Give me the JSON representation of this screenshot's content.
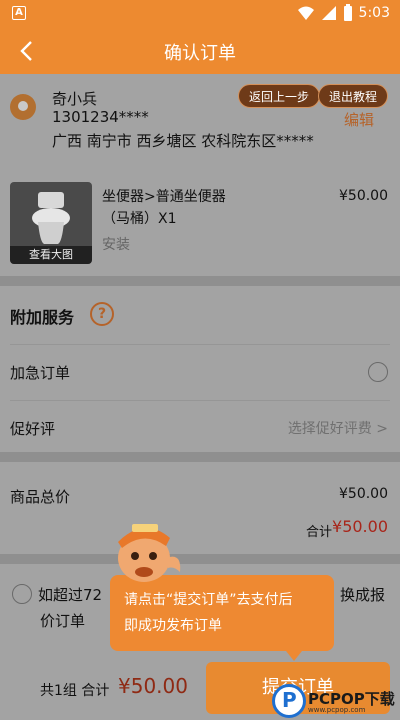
{
  "status_bar": {
    "app_glyph": "A",
    "time": "5:03",
    "icons": [
      "wifi-icon",
      "signal-icon",
      "battery-icon"
    ]
  },
  "header": {
    "title": "确认订单",
    "back_icon": "chevron-left-icon"
  },
  "address": {
    "name": "奇小兵",
    "phone": "1301234****",
    "full": "广西 南宁市 西乡塘区 农科院东区*****",
    "prev_step_label": "返回上一步",
    "exit_tutorial_label": "退出教程",
    "edit_label": "编辑"
  },
  "product": {
    "name": "坐便器>普通坐便器（马桶）X1",
    "service": "安装",
    "price": "¥50.00",
    "thumb_caption": "查看大图"
  },
  "services": {
    "title": "附加服务",
    "help_glyph": "?",
    "urgent_label": "加急订单",
    "praise_label": "促好评",
    "praise_choose": "选择促好评费 >"
  },
  "totals": {
    "goods_label": "商品总价",
    "goods_value": "¥50.00",
    "sum_label": "合计",
    "sum_value": "¥50.00"
  },
  "option72": {
    "line1": "如超过72",
    "line2": "价订单",
    "line3": "换成报"
  },
  "tip": {
    "text_line1": "请点击“提交订单”去支付后",
    "text_line2": "即成功发布订单"
  },
  "bottom": {
    "summary": "共1组 合计",
    "amount": "¥50.00",
    "submit_label": "提交订单"
  },
  "watermark": {
    "text": "PCPOP下载",
    "sub": "www.pcpop.com"
  },
  "colors": {
    "accent": "#ed8a30",
    "price_red": "#a8261b",
    "edit_brown": "#b5632a"
  }
}
